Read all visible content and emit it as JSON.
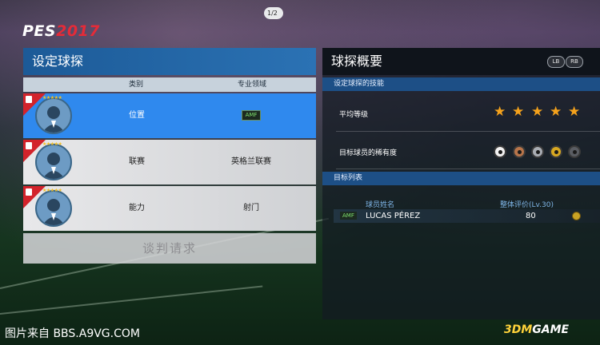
{
  "logo": {
    "main": "PES",
    "year": "2017"
  },
  "left_panel": {
    "title": "设定球探",
    "col_category": "类别",
    "col_specialty": "专业领域",
    "rows": [
      {
        "category": "位置",
        "specialty": "AMF",
        "specialty_is_badge": true,
        "selected": true
      },
      {
        "category": "联赛",
        "specialty": "英格兰联赛",
        "specialty_is_badge": false,
        "selected": false
      },
      {
        "category": "能力",
        "specialty": "射门",
        "specialty_is_badge": false,
        "selected": false
      }
    ],
    "negotiate_label": "谈判请求"
  },
  "right_panel": {
    "title": "球探概要",
    "lb": "LB",
    "rb": "RB",
    "page": "1/2",
    "skills_header": "设定球探的技能",
    "avg_rating_label": "平均等级",
    "avg_rating_stars": 5,
    "rarity_label": "目标球员的稀有度",
    "rarity_colors": [
      "#f2f2f2",
      "#b8754a",
      "#a9adb3",
      "#d8a821",
      "#5a5d63"
    ],
    "target_list_header": "目标列表",
    "col_name": "球员姓名",
    "col_overall": "整体评价(Lv.30)",
    "players": [
      {
        "position": "AMF",
        "name": "LUCAS PÉREZ",
        "overall": "80"
      }
    ]
  },
  "footer": {
    "source": "图片来自 BBS.A9VG.COM",
    "watermark_a": "3DM",
    "watermark_b": "GAME"
  },
  "colors": {
    "selected_row": "#2f89ee",
    "header_blue": "#1c5a97",
    "star": "#f5a21c",
    "tag_red": "#d3232b"
  }
}
